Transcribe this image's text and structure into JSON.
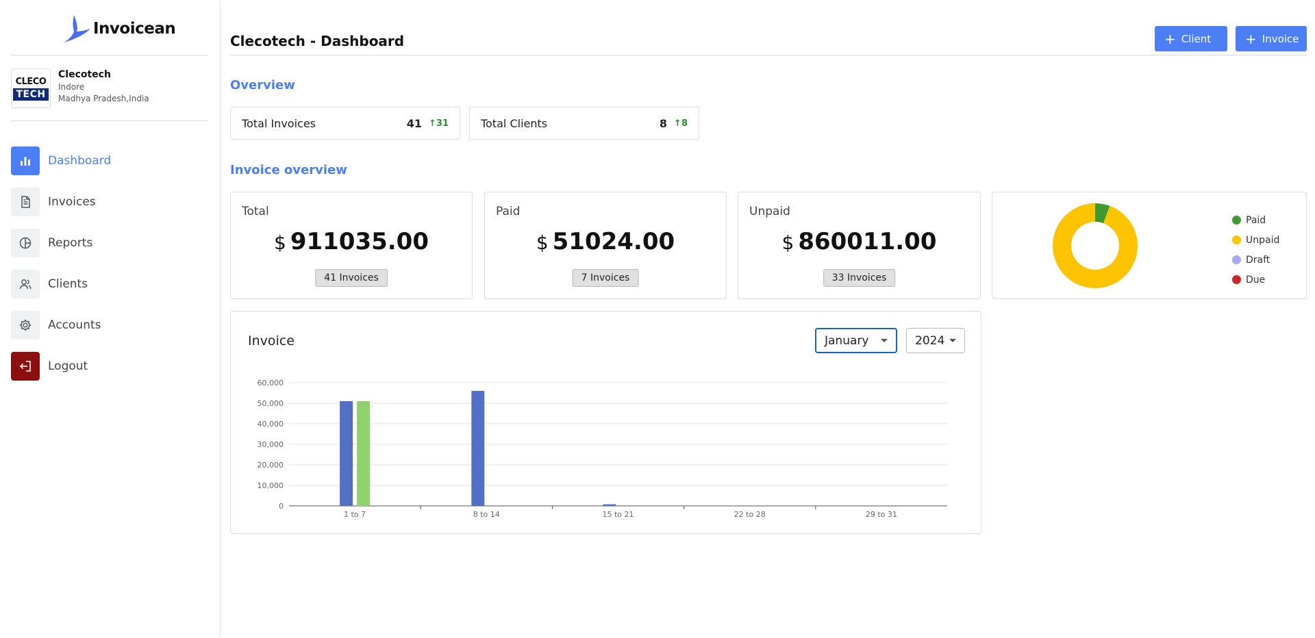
{
  "brand": {
    "name": "Invoicean"
  },
  "company": {
    "logo_line1": "CLECO",
    "logo_line2": "TECH",
    "name": "Clecotech",
    "city": "Indore",
    "region": "Madhya Pradesh,India"
  },
  "nav": {
    "items": [
      {
        "label": "Dashboard",
        "icon": "bar-chart-icon"
      },
      {
        "label": "Invoices",
        "icon": "document-icon"
      },
      {
        "label": "Reports",
        "icon": "pie-chart-icon"
      },
      {
        "label": "Clients",
        "icon": "users-icon"
      },
      {
        "label": "Accounts",
        "icon": "gear-icon"
      },
      {
        "label": "Logout",
        "icon": "logout-icon"
      }
    ]
  },
  "header": {
    "title": "Clecotech - Dashboard",
    "client_button": "Client",
    "invoice_button": "Invoice"
  },
  "overview": {
    "title": "Overview",
    "total_invoices": {
      "label": "Total Invoices",
      "value": "41",
      "change": "31"
    },
    "total_clients": {
      "label": "Total Clients",
      "value": "8",
      "change": "8"
    }
  },
  "invoice_overview": {
    "title": "Invoice overview",
    "cards": [
      {
        "label": "Total",
        "currency": "$",
        "amount": "911035.00",
        "badge": "41 Invoices"
      },
      {
        "label": "Paid",
        "currency": "$",
        "amount": "51024.00",
        "badge": "7 Invoices"
      },
      {
        "label": "Unpaid",
        "currency": "$",
        "amount": "860011.00",
        "badge": "33 Invoices"
      }
    ],
    "legend": [
      {
        "label": "Paid",
        "color": "#3f9a2e"
      },
      {
        "label": "Unpaid",
        "color": "#ffc400"
      },
      {
        "label": "Draft",
        "color": "#a5a8f0"
      },
      {
        "label": "Due",
        "color": "#c62828"
      }
    ]
  },
  "invoice_chart": {
    "title": "Invoice",
    "month": "January",
    "year": "2024"
  },
  "chart_data": [
    {
      "type": "pie",
      "donut": true,
      "labels": [
        "Paid",
        "Unpaid",
        "Draft",
        "Due"
      ],
      "values": [
        51024,
        860011,
        0,
        0
      ],
      "colors": [
        "#3f9a2e",
        "#ffc400",
        "#a5a8f0",
        "#c62828"
      ]
    },
    {
      "type": "bar",
      "title": "Invoice",
      "categories": [
        "1 to 7",
        "8 to 14",
        "15 to 21",
        "22 to 28",
        "29 to 31"
      ],
      "series": [
        {
          "values": [
            51000,
            56000,
            800,
            0,
            0
          ],
          "color": "#5470c6"
        },
        {
          "values": [
            51000,
            0,
            0,
            0,
            0
          ],
          "color": "#8fd16f"
        }
      ],
      "ylim": [
        0,
        60000
      ],
      "yticks": [
        "0",
        "10,000",
        "20,000",
        "30,000",
        "40,000",
        "50,000",
        "60,000"
      ],
      "grid": true
    }
  ]
}
